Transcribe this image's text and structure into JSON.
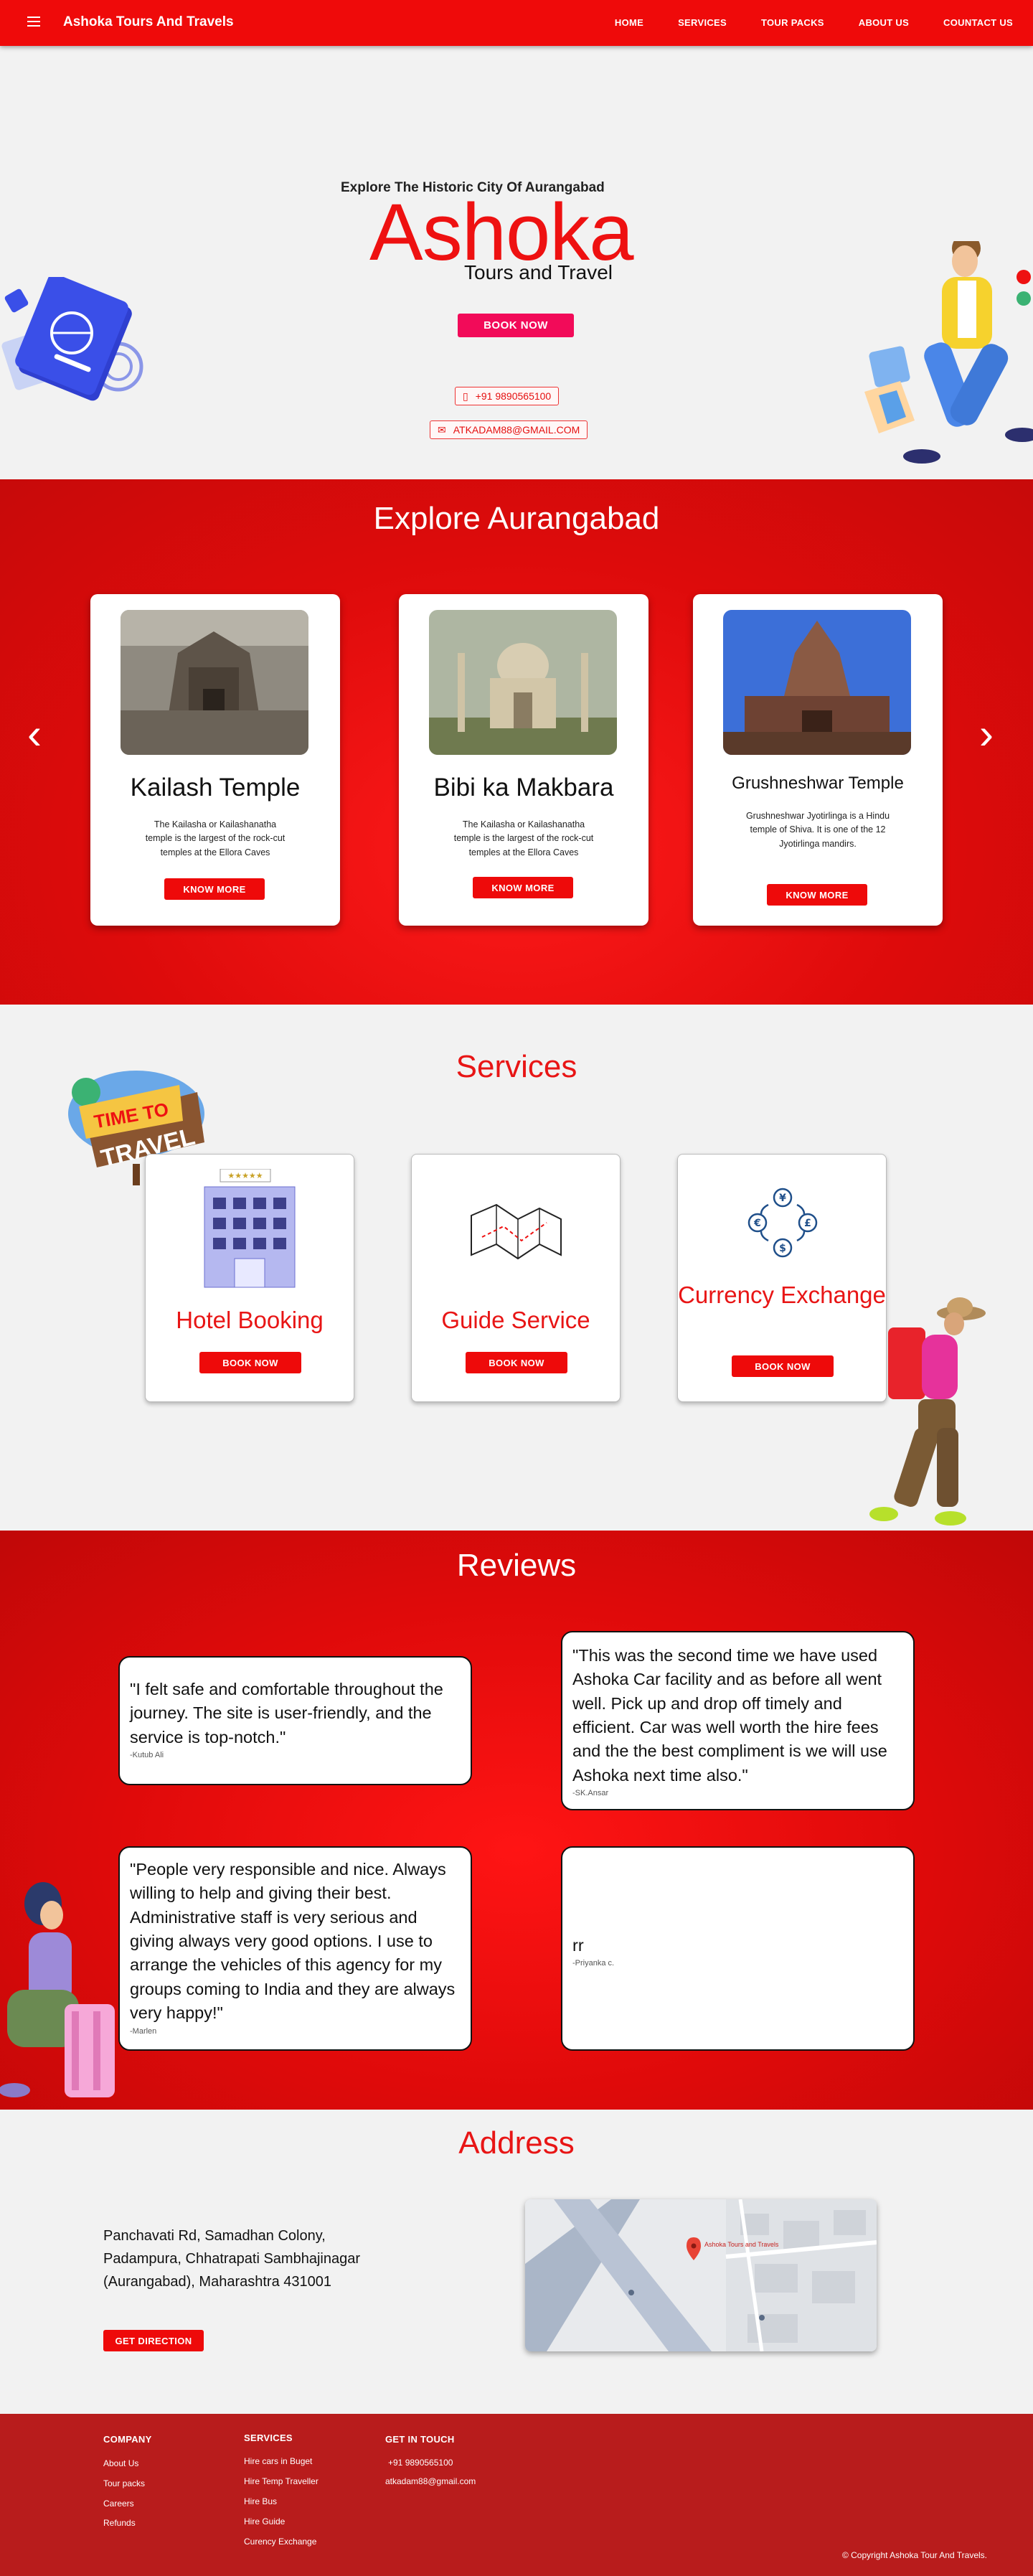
{
  "nav": {
    "brand": "Ashoka Tours And Travels",
    "links": [
      "HOME",
      "SERVICES",
      "TOUR PACKS",
      "ABOUT US",
      "COUNTACT US"
    ]
  },
  "hero": {
    "kicker": "Explore The Historic City Of Aurangabad",
    "title": "Ashoka",
    "subtitle": "Tours and Travel",
    "cta": "BOOK NOW",
    "phone": "+91 9890565100",
    "email": "ATKADAM88@GMAIL.COM"
  },
  "explore": {
    "title": "Explore Aurangabad",
    "cards": [
      {
        "name": "Kailash Temple",
        "desc": "The Kailasha or Kailashanatha temple is the largest of the rock-cut temples at the Ellora Caves",
        "button": "KNOW MORE"
      },
      {
        "name": "Bibi ka Makbara",
        "desc": "The Kailasha or Kailashanatha temple is the largest of the rock-cut temples at the Ellora Caves",
        "button": "KNOW MORE"
      },
      {
        "name": "Grushneshwar Temple",
        "desc": "Grushneshwar Jyotirlinga is a Hindu temple of Shiva. It is one of the 12 Jyotirlinga mandirs.",
        "button": "KNOW MORE"
      }
    ]
  },
  "services": {
    "title": "Services",
    "sticker_line1": "TIME TO",
    "sticker_line2": "TRAVEL",
    "cards": [
      {
        "name": "Hotel Booking",
        "button": "BOOK NOW"
      },
      {
        "name": "Guide Service",
        "button": "BOOK NOW"
      },
      {
        "name": "Currency Exchange",
        "button": "BOOK NOW"
      }
    ]
  },
  "reviews": {
    "title": "Reviews",
    "items": [
      {
        "text": "\"I felt safe and comfortable throughout the journey. The site is user-friendly, and the service is top-notch.\"",
        "author": "-Kutub Ali"
      },
      {
        "text": "\"This was the second time we have used Ashoka Car facility and as before all went well. Pick up and drop off timely and efficient. Car was well worth the hire fees and the the best compliment is we will use Ashoka next time also.\"",
        "author": "-SK.Ansar"
      },
      {
        "text": "\"People very responsible and nice. Always willing to help and giving their best. Administrative staff is very serious and giving always very good options. I use to arrange the vehicles of this agency for my groups coming to India and they are always very happy!\"",
        "author": "-Marlen"
      },
      {
        "text": "rr",
        "author": "-Priyanka c."
      }
    ]
  },
  "address": {
    "title": "Address",
    "lines": [
      "Panchavati Rd, Samadhan Colony,",
      "Padampura, Chhatrapati Sambhajinagar",
      "(Aurangabad), Maharashtra 431001"
    ],
    "button": "GET DIRECTION",
    "map_pin_label": "Ashoka Tours and Travels"
  },
  "footer": {
    "company_title": "COMPANY",
    "company_links": [
      "About Us",
      "Tour packs",
      "Careers",
      "Refunds"
    ],
    "services_title": "SERVICES",
    "services_links": [
      "Hire cars in Buget",
      "Hire Temp Traveller",
      "Hire Bus",
      "Hire Guide",
      "Curency Exchange"
    ],
    "contact_title": "GET IN TOUCH",
    "phone": "+91 9890565100",
    "email": "atkadam88@gmail.com",
    "copyright": "© Copyright Ashoka Tour And Travels."
  },
  "colors": {
    "primary": "#ee0a0a",
    "cta_pink": "#f20b59",
    "footer": "#b81c1c"
  },
  "icons": [
    "menu-icon",
    "phone-icon",
    "mail-icon",
    "chevron-left-icon",
    "chevron-right-icon",
    "map-pin-icon"
  ]
}
